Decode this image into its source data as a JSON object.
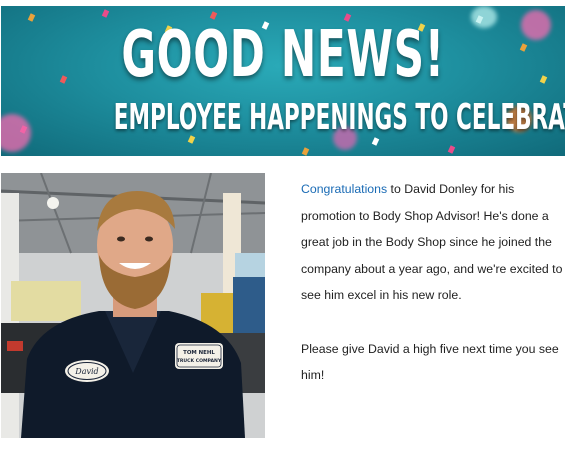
{
  "banner": {
    "headline": "GOOD NEWS!",
    "subheadline": "EMPLOYEE HAPPENINGS TO CELEBRATE",
    "background_color": "#1e8f9f"
  },
  "photo": {
    "name_patch": "David",
    "company_patch_line1": "TOM NEHL",
    "company_patch_line2": "TRUCK COMPANY",
    "shirt_color": "#0f1a2a"
  },
  "article": {
    "link_text": "Congratulations",
    "paragraph1_rest": " to David Donley for his promotion to Body Shop Advisor! He's done a great job in the Body Shop since he joined the company about a year ago, and we're excited to see him excel in his new role.",
    "paragraph2": "Please give David a high five next time you see him!",
    "link_color": "#1a6bb5"
  }
}
